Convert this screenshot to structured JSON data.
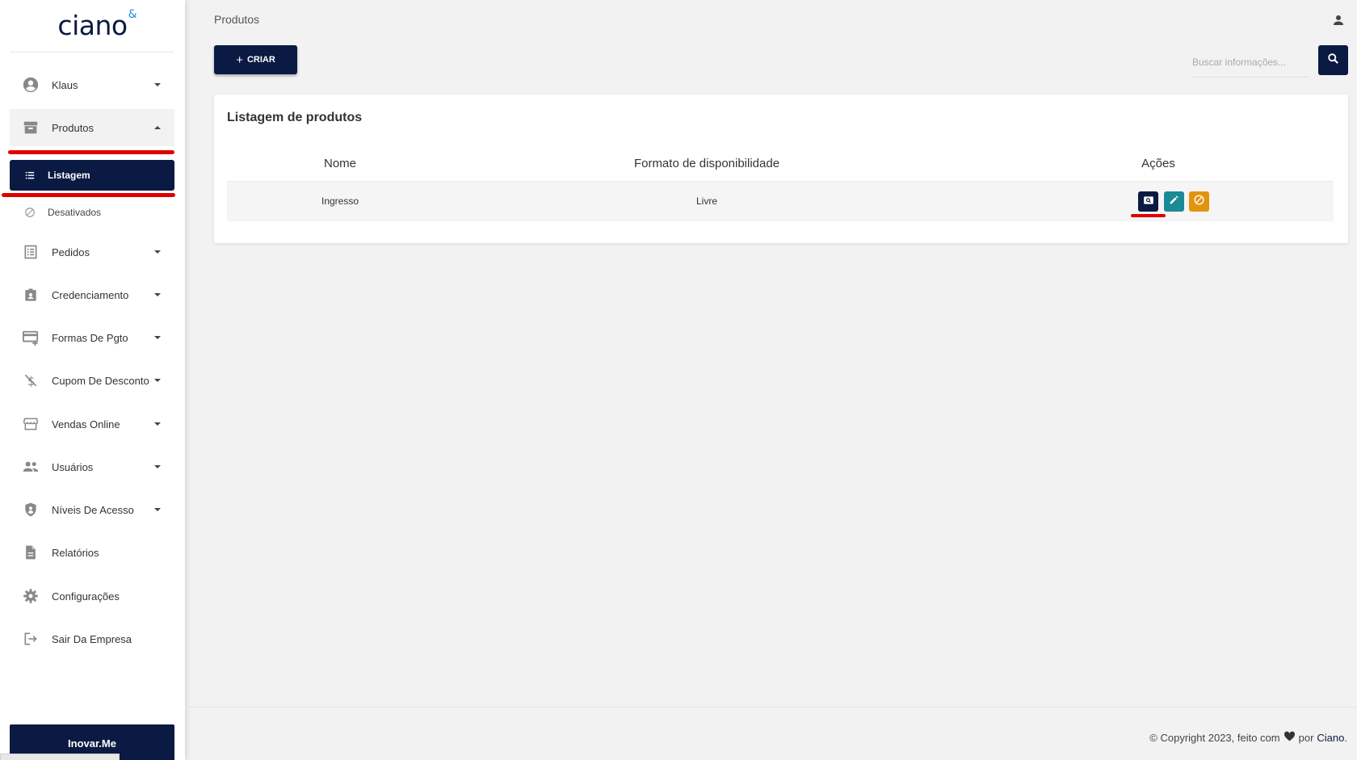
{
  "app": {
    "logo_text": "ciano",
    "logo_mark": "&"
  },
  "sidebar": {
    "user": {
      "label": "Klaus",
      "icon": "account-circle-icon"
    },
    "items": [
      {
        "label": "Produtos",
        "icon": "archive-icon"
      },
      {
        "label": "Listagem",
        "icon": "list-icon"
      },
      {
        "label": "Desativados",
        "icon": "block-icon"
      },
      {
        "label": "Pedidos",
        "icon": "receipt-list-icon"
      },
      {
        "label": "Credenciamento",
        "icon": "badge-icon"
      },
      {
        "label": "Formas De Pgto",
        "icon": "credit-card-add-icon"
      },
      {
        "label": "Cupom De Desconto",
        "icon": "money-off-icon"
      },
      {
        "label": "Vendas Online",
        "icon": "storefront-icon"
      },
      {
        "label": "Usuários",
        "icon": "people-icon"
      },
      {
        "label": "Níveis De Acesso",
        "icon": "shield-person-icon"
      },
      {
        "label": "Relatórios",
        "icon": "document-icon"
      },
      {
        "label": "Configurações",
        "icon": "gear-icon"
      },
      {
        "label": "Sair Da Empresa",
        "icon": "logout-icon"
      }
    ],
    "bottom_label": "Inovar.Me",
    "accent_color": "#0b1a42",
    "highlight_color": "#e00000"
  },
  "header": {
    "breadcrumb": "Produtos",
    "create_button": "CRIAR",
    "search_placeholder": "Buscar informações..."
  },
  "card": {
    "title": "Listagem de produtos",
    "columns": [
      "Nome",
      "Formato de disponibilidade",
      "Ações"
    ],
    "rows": [
      {
        "nome": "Ingresso",
        "formato": "Livre"
      }
    ],
    "action_colors": {
      "view": "#0b1a42",
      "edit": "#1a8a96",
      "disable": "#e3940f"
    }
  },
  "footer": {
    "prefix": "© Copyright 2023, feito com",
    "middle": "por",
    "brand": "Ciano",
    "suffix": "."
  }
}
